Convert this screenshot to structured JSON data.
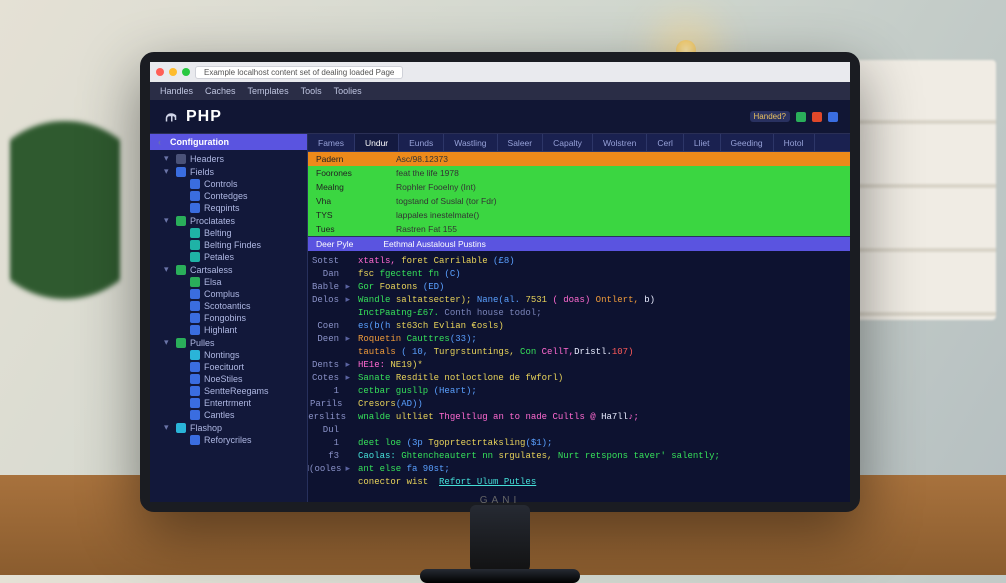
{
  "window": {
    "traffic": [
      "#ff5f57",
      "#febc2e",
      "#28c840"
    ],
    "tab_title": "Example localhost content set of dealing loaded Page"
  },
  "menubar": [
    "Handles",
    "Caches",
    "Templates",
    "Tools",
    "Toolies"
  ],
  "header": {
    "logo_text": "PHP",
    "badges": [
      "Handed?"
    ],
    "squares": [
      "#2aae5a",
      "#e0482a",
      "#3a6de0"
    ]
  },
  "sidebar": {
    "title": "Configuration",
    "items": [
      {
        "lvl": 1,
        "chev": "▾",
        "color": "c-gray",
        "label": "Headers"
      },
      {
        "lvl": 1,
        "chev": "▾",
        "color": "c-blue",
        "label": "Fields"
      },
      {
        "lvl": 2,
        "chev": "",
        "color": "c-blue",
        "label": "Controls"
      },
      {
        "lvl": 2,
        "chev": "",
        "color": "c-blue",
        "label": "Contedges"
      },
      {
        "lvl": 2,
        "chev": "",
        "color": "c-blue",
        "label": "Reqpints"
      },
      {
        "lvl": 1,
        "chev": "▾",
        "color": "c-green",
        "label": "Proclatates"
      },
      {
        "lvl": 2,
        "chev": "",
        "color": "c-teal",
        "label": "Belting"
      },
      {
        "lvl": 2,
        "chev": "",
        "color": "c-teal",
        "label": "Belting Findes"
      },
      {
        "lvl": 2,
        "chev": "",
        "color": "c-teal",
        "label": "Petales"
      },
      {
        "lvl": 1,
        "chev": "▾",
        "color": "c-green",
        "label": "Cartsaless"
      },
      {
        "lvl": 2,
        "chev": "",
        "color": "c-green",
        "label": "Elsa"
      },
      {
        "lvl": 2,
        "chev": "",
        "color": "c-blue",
        "label": "Complus"
      },
      {
        "lvl": 2,
        "chev": "",
        "color": "c-blue",
        "label": "Scotoantics"
      },
      {
        "lvl": 2,
        "chev": "",
        "color": "c-blue",
        "label": "Fongobins"
      },
      {
        "lvl": 2,
        "chev": "",
        "color": "c-blue",
        "label": "Highlant"
      },
      {
        "lvl": 1,
        "chev": "▾",
        "color": "c-green",
        "label": "Pulles"
      },
      {
        "lvl": 2,
        "chev": "",
        "color": "c-cyan",
        "label": "Nontings"
      },
      {
        "lvl": 2,
        "chev": "",
        "color": "c-blue",
        "label": "Foecituort"
      },
      {
        "lvl": 2,
        "chev": "",
        "color": "c-blue",
        "label": "NoeStiles"
      },
      {
        "lvl": 2,
        "chev": "",
        "color": "c-blue",
        "label": "SentteReegams"
      },
      {
        "lvl": 2,
        "chev": "",
        "color": "c-blue",
        "label": "Entertrment"
      },
      {
        "lvl": 2,
        "chev": "",
        "color": "c-blue",
        "label": "Cantles"
      },
      {
        "lvl": 1,
        "chev": "▾",
        "color": "c-cyan",
        "label": "Flashop"
      },
      {
        "lvl": 2,
        "chev": "",
        "color": "c-blue",
        "label": "Reforycriles"
      }
    ]
  },
  "tabs": [
    "Fames",
    "Undur",
    "Eunds",
    "Wastling",
    "Saleer",
    "Capalty",
    "Wolstren",
    "Cerl",
    "Lliet",
    "Geeding",
    "Hotol"
  ],
  "active_tab": 1,
  "panel": [
    {
      "k": "Padern",
      "v": "Asc/98.12373",
      "bg": "bg-or"
    },
    {
      "k": "Foorones",
      "v": "feat the life 1978",
      "bg": "bg-gr"
    },
    {
      "k": "Mealng",
      "v": "Rophler Fooelny (Int)",
      "bg": "bg-gr"
    },
    {
      "k": "Vha",
      "v": "togstand of Suslal (tor Fdr)",
      "bg": "bg-gr"
    },
    {
      "k": "TYS",
      "v": "lappales inestelmate()",
      "bg": "bg-gr"
    },
    {
      "k": "Tues",
      "v": "Rastren Fat 155",
      "bg": "bg-gr"
    }
  ],
  "section": {
    "left": "Deer Pyle",
    "right": "Eethmal Austalousl Pustins"
  },
  "code": [
    {
      "g": "Sotst",
      "tw": "",
      "spans": [
        [
          "t-pink",
          "xtatls, "
        ],
        [
          "t-yellow",
          "foret Carrilable "
        ],
        [
          "t-blue",
          "(£8)"
        ]
      ]
    },
    {
      "g": "Dan",
      "tw": "",
      "spans": [
        [
          "t-yellow",
          "fsc "
        ],
        [
          "t-green",
          "fgectent fn "
        ],
        [
          "t-blue",
          "(C)"
        ]
      ]
    },
    {
      "g": "Bable",
      "tw": "▸",
      "spans": [
        [
          "t-green",
          "Gor "
        ],
        [
          "t-yellow",
          "Foatons "
        ],
        [
          "t-blue",
          "(ED)"
        ]
      ]
    },
    {
      "g": "Delos",
      "tw": "▸",
      "spans": [
        [
          "t-green",
          "Wandle "
        ],
        [
          "t-yellow",
          "saltatsecter); "
        ],
        [
          "t-blue",
          "Nane(al. "
        ],
        [
          "t-yellow",
          "7531 "
        ],
        [
          "t-pink",
          "( doas) "
        ],
        [
          "t-orange",
          "Ontlert, "
        ],
        [
          "t-white",
          "b)"
        ]
      ]
    },
    {
      "g": "",
      "tw": "",
      "spans": [
        [
          "t-green",
          "InctPaatng-£67. "
        ],
        [
          "t-dim",
          "Conth house todol;"
        ]
      ]
    },
    {
      "g": "Coen",
      "tw": "",
      "spans": [
        [
          "t-blue",
          "es(b(h "
        ],
        [
          "t-yellow",
          "st63ch Evlian €osls)"
        ]
      ]
    },
    {
      "g": "Deen",
      "tw": "▸",
      "spans": [
        [
          "t-orange",
          "Roquetin "
        ],
        [
          "t-green",
          "Cauttres"
        ],
        [
          "t-blue",
          "(33);"
        ]
      ]
    },
    {
      "g": "",
      "tw": "",
      "spans": [
        [
          "t-orange",
          "tautals "
        ],
        [
          "t-blue",
          "( 10, "
        ],
        [
          "t-yellow",
          "Turgrstuntings, "
        ],
        [
          "t-green",
          "Con "
        ],
        [
          "t-pink",
          "CellT,"
        ],
        [
          "t-white",
          "Dristl."
        ],
        [
          "t-red",
          "107)"
        ]
      ]
    },
    {
      "g": "Dents",
      "tw": "▸",
      "spans": [
        [
          "t-pink",
          "HE1e: "
        ],
        [
          "t-yellow",
          "NE19)*"
        ]
      ]
    },
    {
      "g": "Cotes",
      "tw": "▸",
      "spans": [
        [
          "t-green",
          "Sanate "
        ],
        [
          "t-yellow",
          "Resditle notloctlone de fwforl)"
        ]
      ]
    },
    {
      "g": "1",
      "tw": "",
      "spans": [
        [
          "t-green",
          "cetbar gusllp "
        ],
        [
          "t-blue",
          "(Heart);"
        ]
      ]
    },
    {
      "g": "Parils",
      "tw": "",
      "spans": [
        [
          "t-yellow",
          "Cresors"
        ],
        [
          "t-blue",
          "(AD))"
        ]
      ]
    },
    {
      "g": "Eperslits",
      "tw": "",
      "spans": [
        [
          "t-green",
          "wnalde "
        ],
        [
          "t-yellow",
          "ultliet "
        ],
        [
          "t-pink",
          "Thgeltlug an to nade Cultls @ "
        ],
        [
          "t-white",
          "Ha7ll"
        ],
        [
          "t-pink",
          "♪;"
        ]
      ]
    },
    {
      "g": "Dul",
      "tw": "",
      "spans": [
        [
          "t-white",
          ""
        ]
      ]
    },
    {
      "g": "1",
      "tw": "",
      "spans": [
        [
          "t-green",
          "deet loe "
        ],
        [
          "t-blue",
          "(3p "
        ],
        [
          "t-yellow",
          "Tgoprtectrtaksling"
        ],
        [
          "t-blue",
          "($1);"
        ]
      ]
    },
    {
      "g": "f3",
      "tw": "",
      "spans": [
        [
          "t-cyan",
          "Caolas: "
        ],
        [
          "t-green",
          "Ghtencheautert nn "
        ],
        [
          "t-yellow",
          "srgulates, "
        ],
        [
          "t-green",
          "Nurt retspons taver' salently;"
        ]
      ]
    },
    {
      "g": "M(ooles",
      "tw": "▸",
      "spans": [
        [
          "t-green",
          "ant else "
        ],
        [
          "t-blue",
          "fa 90st;"
        ]
      ]
    },
    {
      "g": "",
      "tw": "",
      "spans": [
        [
          "t-yellow",
          "conector wist  "
        ],
        [
          "t-cyan underline",
          "Refort Ulum Putles"
        ]
      ]
    }
  ],
  "brand": "GANI"
}
